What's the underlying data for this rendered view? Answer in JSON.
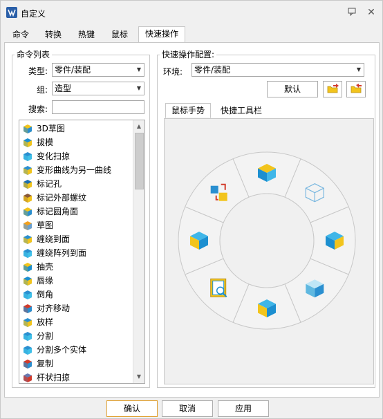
{
  "window": {
    "title": "自定义"
  },
  "tabs": [
    {
      "label": "命令"
    },
    {
      "label": "转换"
    },
    {
      "label": "热键"
    },
    {
      "label": "鼠标"
    },
    {
      "label": "快速操作"
    }
  ],
  "command_list": {
    "group_title": "命令列表",
    "type_label": "类型:",
    "type_value": "零件/装配",
    "group_label": "组:",
    "group_value": "造型",
    "search_label": "搜索:",
    "search_value": "",
    "items": [
      {
        "label": "3D草图",
        "icon": "sketch-3d-icon"
      },
      {
        "label": "拔模",
        "icon": "draft-icon"
      },
      {
        "label": "变化扫掠",
        "icon": "variable-sweep-icon"
      },
      {
        "label": "变形曲线为另一曲线",
        "icon": "morph-curve-icon"
      },
      {
        "label": "标记孔",
        "icon": "hole-mark-icon"
      },
      {
        "label": "标记外部螺纹",
        "icon": "thread-mark-icon"
      },
      {
        "label": "标记圆角面",
        "icon": "fillet-mark-icon"
      },
      {
        "label": "草图",
        "icon": "sketch-icon"
      },
      {
        "label": "缠绕到面",
        "icon": "wrap-face-icon"
      },
      {
        "label": "缠绕阵列到面",
        "icon": "wrap-pattern-icon"
      },
      {
        "label": "抽壳",
        "icon": "shell-icon"
      },
      {
        "label": "唇缘",
        "icon": "lip-icon"
      },
      {
        "label": "倒角",
        "icon": "chamfer-icon"
      },
      {
        "label": "对齐移动",
        "icon": "align-move-icon"
      },
      {
        "label": "放样",
        "icon": "loft-icon"
      },
      {
        "label": "分割",
        "icon": "split-icon"
      },
      {
        "label": "分割多个实体",
        "icon": "split-multi-icon"
      },
      {
        "label": "复制",
        "icon": "copy-icon"
      },
      {
        "label": "杆状扫掠",
        "icon": "rod-sweep-icon"
      }
    ]
  },
  "quick_config": {
    "group_title": "快速操作配置:",
    "env_label": "环境:",
    "env_value": "零件/装配",
    "default_label": "默认",
    "subtabs": [
      {
        "label": "鼠标手势"
      },
      {
        "label": "快捷工具栏"
      }
    ],
    "wheel_slots": [
      {
        "icon": "cube-top-icon"
      },
      {
        "icon": "cube-wireframe-icon"
      },
      {
        "icon": "cube-front-right-icon"
      },
      {
        "icon": "cube-shaded-icon"
      },
      {
        "icon": "cube-bottom-icon"
      },
      {
        "icon": "document-view-icon"
      },
      {
        "icon": "cube-left-icon"
      },
      {
        "icon": "view-swap-icon"
      }
    ]
  },
  "footer": {
    "ok_label": "确认",
    "cancel_label": "取消",
    "apply_label": "应用"
  },
  "colors": {
    "accent_border": "#e0a030",
    "cube_blue": "#1c8fd0",
    "cube_yellow": "#f2c41c"
  }
}
